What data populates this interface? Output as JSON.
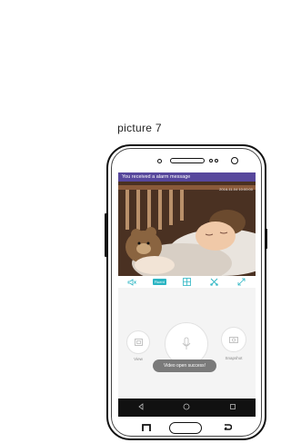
{
  "caption": "picture 7",
  "app": {
    "alarm_message": "You received a alarm message",
    "timestamp": "2016-11-04 10:00:00",
    "toolbar": {
      "fluent_label": "Fluent"
    },
    "controls": {
      "view_label": "View",
      "snapshot_label": "Snapshot"
    },
    "toast": "Video open success!"
  },
  "icons": {
    "speaker": "speaker-icon",
    "split": "split-screen-icon",
    "cut": "scissors-icon",
    "fullscreen": "fullscreen-icon",
    "video": "video-icon",
    "mic": "microphone-icon",
    "camera": "camera-icon",
    "back": "back-icon",
    "home": "home-icon",
    "recent": "recent-apps-icon"
  },
  "colors": {
    "alarm_bar": "#57479c",
    "accent": "#2bb5c3"
  }
}
